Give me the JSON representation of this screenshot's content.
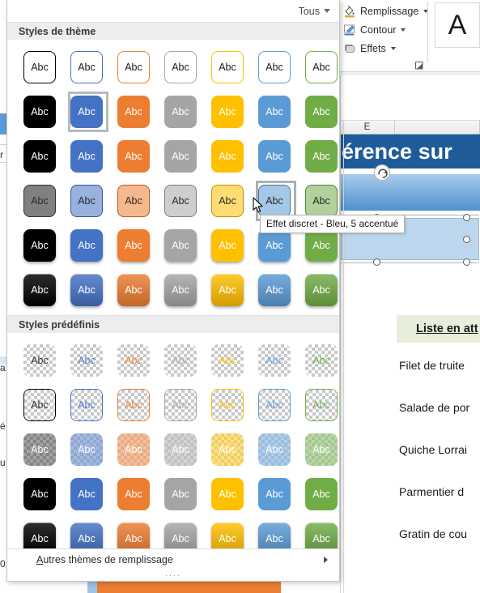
{
  "gallery": {
    "filter_label": "Tous",
    "sections": [
      {
        "title": "Styles de thème"
      },
      {
        "title": "Styles prédéfinis"
      }
    ],
    "swatch_label": "Abc",
    "footer": {
      "more_fills_label": "Autres thèmes de remplissage",
      "more_fills_accesskey": "A",
      "grip_label": "...."
    },
    "selected_index_theme_row2": 1,
    "hovered_index_theme_row4": 5,
    "accent_colors": [
      "#000000",
      "#4472C4",
      "#ED7D31",
      "#A5A5A5",
      "#FFC000",
      "#5B9BD5",
      "#70AD47"
    ]
  },
  "tooltip": {
    "text": "Effet discret - Bleu, 5 accentué"
  },
  "ribbon": {
    "items": [
      {
        "label": "Remplissage",
        "icon": "fill-bucket-icon"
      },
      {
        "label": "Contour",
        "icon": "outline-pen-icon"
      },
      {
        "label": "Effets",
        "icon": "effects-icon"
      }
    ],
    "font_preview": "A",
    "dialog_launcher_icon": "dialog-launcher-icon"
  },
  "sheet": {
    "column_headers": [
      "E",
      ""
    ],
    "banner_text": "érence sur",
    "list_header": "Liste en att",
    "list_items": [
      "Filet de truite",
      "Salade de por",
      "Quiche Lorrai",
      "Parmentier d",
      "Gratin de cou"
    ]
  }
}
